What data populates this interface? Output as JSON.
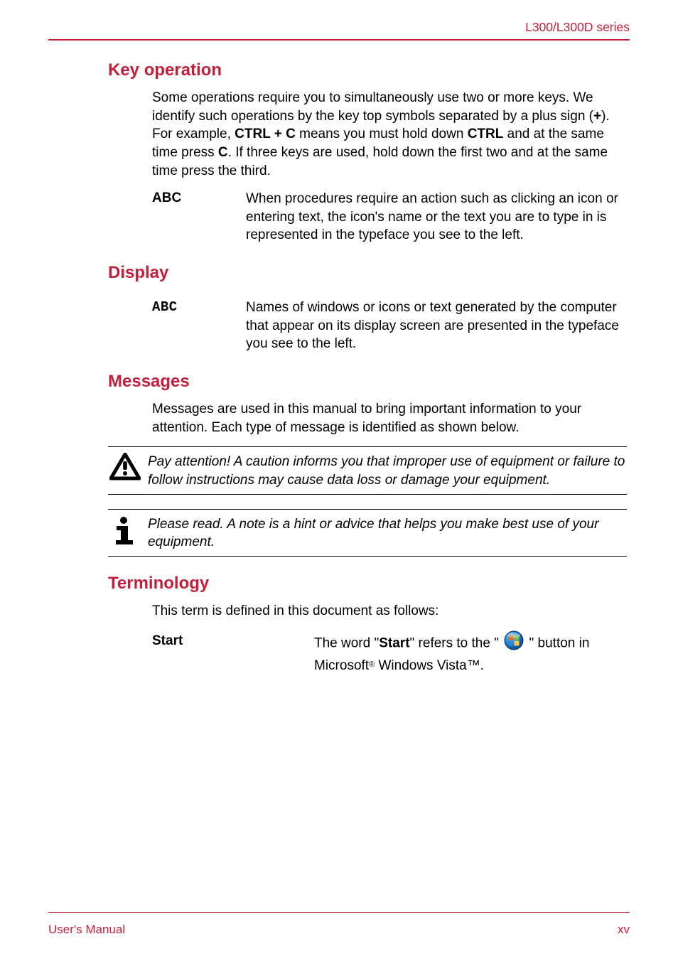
{
  "header": {
    "series_text": "L300/L300D series"
  },
  "sections": {
    "key_operation": {
      "heading": "Key operation",
      "paragraph_parts": {
        "p1": "Some operations require you to simultaneously use two or more keys. We identify such operations by the key top symbols separated by a plus sign (",
        "plus": "+",
        "p2": "). For example, ",
        "ctrlc": "CTRL + C",
        "p3": " means you must hold down ",
        "ctrl": "CTRL",
        "p4": " and at the same time press ",
        "c": "C",
        "p5": ". If three keys are used, hold down the first two and at the same time press the third."
      },
      "abc": {
        "term": "ABC",
        "desc": "When procedures require an action such as clicking an icon or entering text, the icon's name or the text you are to type in is represented in the typeface you see to the left."
      }
    },
    "display": {
      "heading": "Display",
      "abc": {
        "term": "ABC",
        "desc": "Names of windows or icons or text generated by the computer that appear on its display screen are presented in the typeface you see to the left."
      }
    },
    "messages": {
      "heading": "Messages",
      "paragraph": "Messages are used in this manual to bring important information to your attention. Each type of message is identified as shown below.",
      "caution": "Pay attention! A caution informs you that improper use of equipment or failure to follow instructions may cause data loss or damage your equipment.",
      "note": "Please read. A note is a hint or advice that helps you make best use of your equipment."
    },
    "terminology": {
      "heading": "Terminology",
      "intro": "This term is defined in this document as follows:",
      "start": {
        "term": "Start",
        "pre": "The word \"",
        "word": "Start",
        "mid": "\" refers to the \" ",
        "post": " \" button in Microsoft",
        "vista": " Windows Vista™."
      }
    }
  },
  "footer": {
    "left": "User's Manual",
    "right": "xv"
  }
}
